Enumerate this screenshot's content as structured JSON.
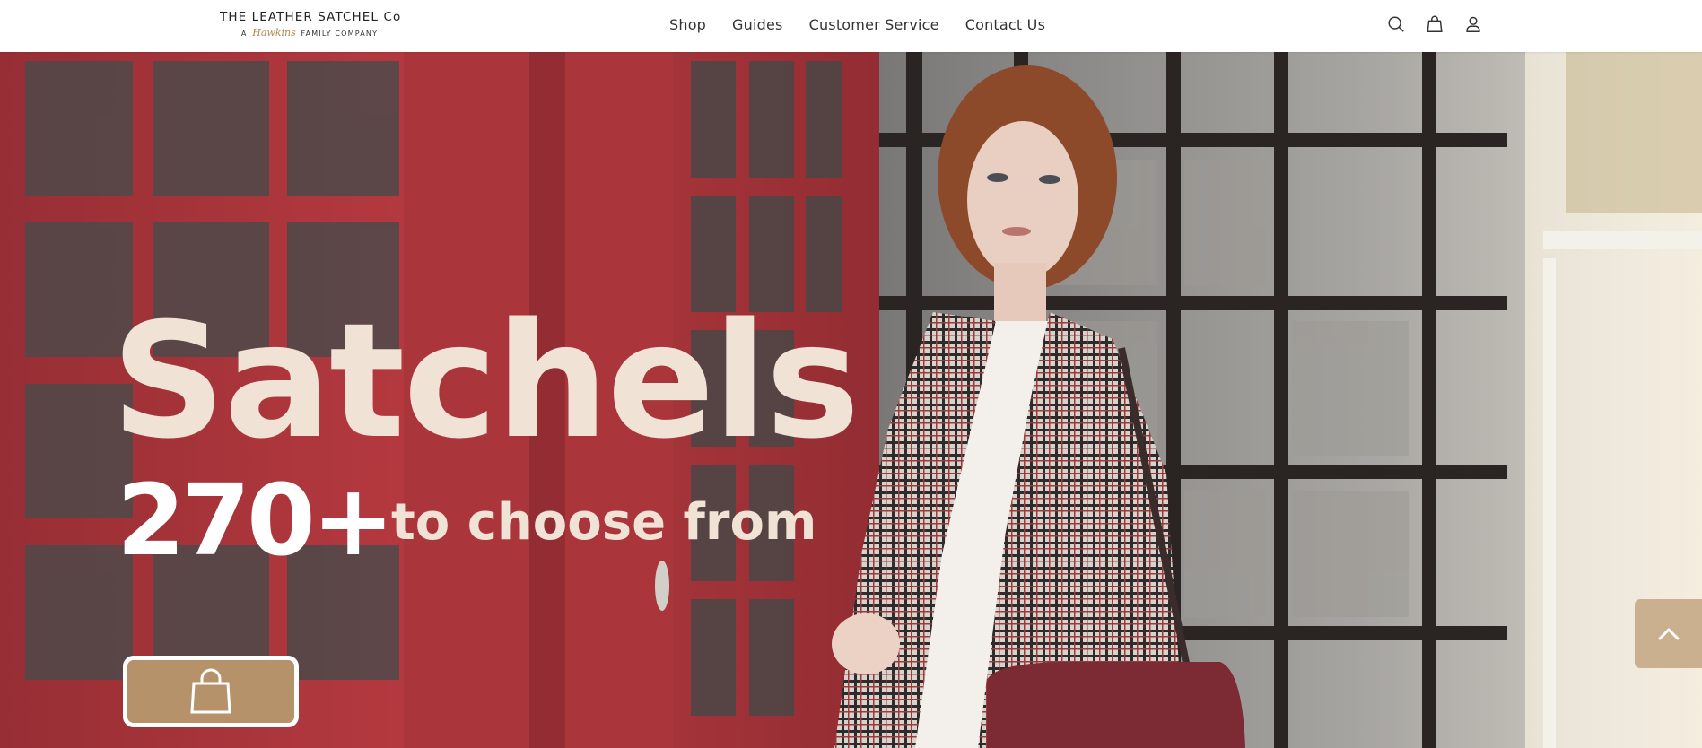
{
  "header": {
    "logo": {
      "title": "THE LEATHER SATCHEL Co",
      "tagline_prefix": "A",
      "tagline_script": "Hawkins",
      "tagline_suffix": "FAMILY COMPANY"
    },
    "nav": [
      {
        "label": "Shop"
      },
      {
        "label": "Guides"
      },
      {
        "label": "Customer Service"
      },
      {
        "label": "Contact Us"
      }
    ],
    "icons": [
      "search-icon",
      "shopping-bag-icon",
      "account-icon"
    ]
  },
  "hero": {
    "headline": "Satchels",
    "count": "270+",
    "count_suffix": "to choose from",
    "cta_icon": "shopping-bag-icon",
    "colors": {
      "headline": "#f1e2d6",
      "cta_background": "#b5926a",
      "phone_box_red": "#a8232a",
      "back_to_top": "#c9ad8b"
    }
  },
  "back_to_top": {
    "icon": "chevron-up-icon"
  }
}
